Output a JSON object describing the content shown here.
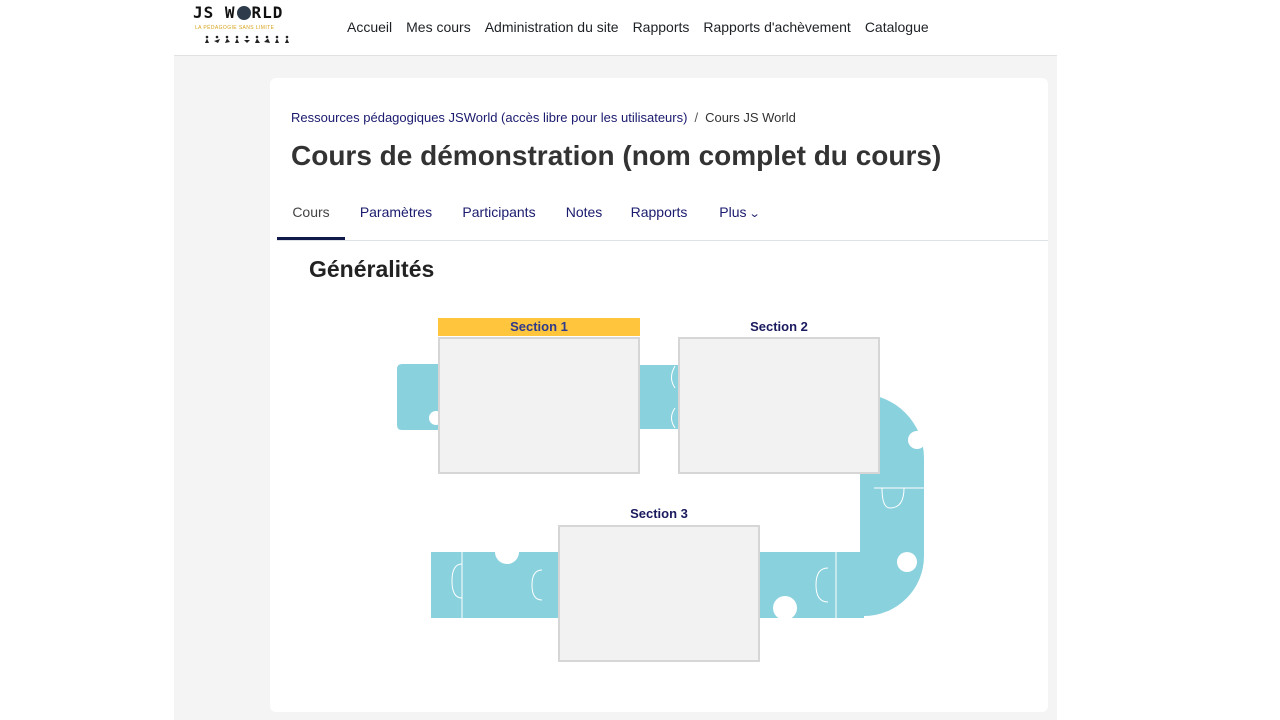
{
  "brand": {
    "logo_title_left": "JS W",
    "logo_title_right": "RLD",
    "tagline": "LA PÉDAGOGIE SANS LIMITE"
  },
  "nav": {
    "items": [
      "Accueil",
      "Mes cours",
      "Administration du site",
      "Rapports",
      "Rapports d'achèvement",
      "Catalogue"
    ]
  },
  "breadcrumb": {
    "items": [
      "Ressources pédagogiques JSWorld (accès libre pour les utilisateurs)",
      "Cours JS World"
    ],
    "separator": "/"
  },
  "page": {
    "title": "Cours de démonstration (nom complet du cours)"
  },
  "tabs": {
    "items": [
      "Cours",
      "Paramètres",
      "Participants",
      "Notes",
      "Rapports",
      "Plus"
    ],
    "active": "Cours",
    "more_chevron": "⌄"
  },
  "general": {
    "heading": "Généralités",
    "sections": [
      {
        "label": "Section 1",
        "highlighted": true
      },
      {
        "label": "Section 2",
        "highlighted": false
      },
      {
        "label": "Section 3",
        "highlighted": false
      }
    ]
  },
  "colors": {
    "highlight": "#fec53d",
    "puzzle": "#8ad1de",
    "link": "#1a1a6e",
    "active_tab_underline": "#0f1a4a"
  }
}
